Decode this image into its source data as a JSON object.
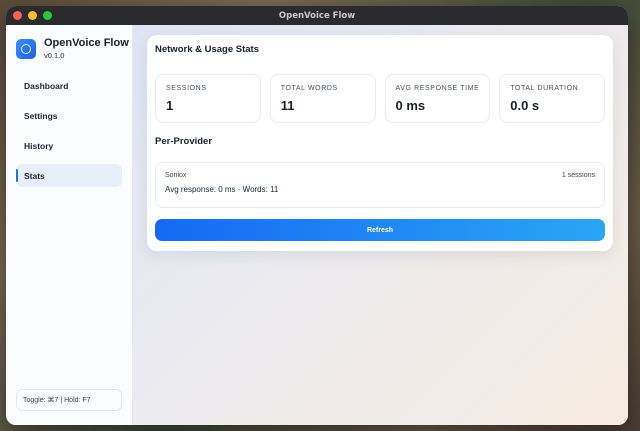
{
  "window": {
    "title": "OpenVoice Flow"
  },
  "brand": {
    "name": "OpenVoice Flow",
    "version": "v0.1.0"
  },
  "sidebar": {
    "items": [
      {
        "label": "Dashboard",
        "active": false
      },
      {
        "label": "Settings",
        "active": false
      },
      {
        "label": "History",
        "active": false
      },
      {
        "label": "Stats",
        "active": true
      }
    ],
    "shortcut": "Toggle: ⌘7 | Hold: F7"
  },
  "stats": {
    "title": "Network & Usage Stats",
    "cards": [
      {
        "label": "SESSIONS",
        "value": "1"
      },
      {
        "label": "TOTAL WORDS",
        "value": "11"
      },
      {
        "label": "AVG RESPONSE TIME",
        "value": "0 ms"
      },
      {
        "label": "TOTAL DURATION",
        "value": "0.0 s"
      }
    ],
    "per_provider_title": "Per-Provider",
    "providers": [
      {
        "name": "Soniox",
        "sessions": "1 sessions",
        "summary": "Avg response: 0 ms · Words: 11"
      }
    ],
    "refresh_label": "Refresh"
  },
  "colors": {
    "accent": "#1e6ef5",
    "active_nav_bg": "#e7effb",
    "button_gradient_start": "#1668f4",
    "button_gradient_end": "#2aa6f5"
  }
}
